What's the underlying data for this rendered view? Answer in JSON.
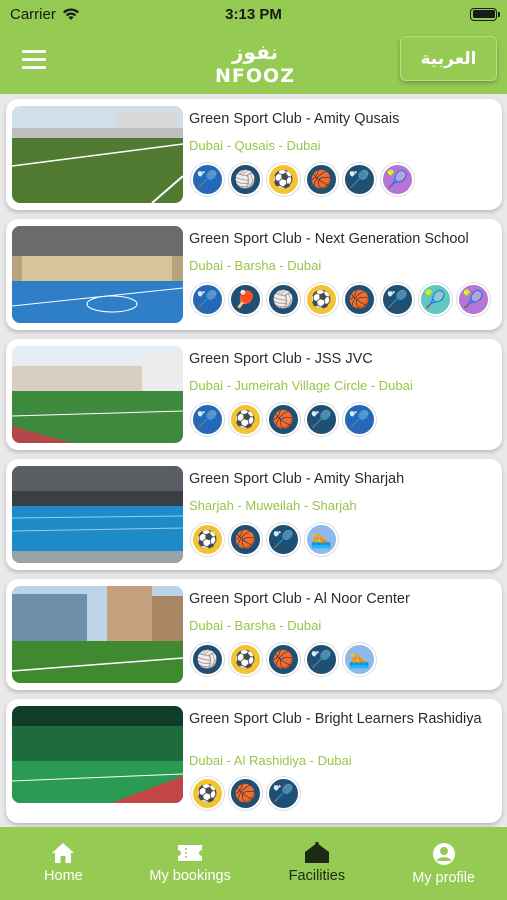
{
  "status": {
    "carrier": "Carrier",
    "time": "3:13 PM"
  },
  "header": {
    "lang_button": "العربية",
    "logo_text": "NFOOZ",
    "logo_arabic": "نفوز"
  },
  "clubs": [
    {
      "title": "Green Sport Club - Amity Qusais",
      "location": "Dubai - Qusais - Dubai",
      "sports": [
        [
          "badminton",
          "s-blue",
          "🏸"
        ],
        [
          "volleyball",
          "s-dark",
          "🏐"
        ],
        [
          "football",
          "s-yellow",
          "⚽"
        ],
        [
          "basketball",
          "s-dark",
          "🏀"
        ],
        [
          "badminton-shuttle",
          "s-dark",
          "🏸"
        ],
        [
          "padel",
          "s-purple",
          "🎾"
        ]
      ]
    },
    {
      "title": "Green Sport Club - Next Generation School",
      "location": "Dubai - Barsha - Dubai",
      "sports": [
        [
          "badminton",
          "s-blue",
          "🏸"
        ],
        [
          "table-tennis",
          "s-dark",
          "🏓"
        ],
        [
          "volleyball",
          "s-dark",
          "🏐"
        ],
        [
          "football",
          "s-yellow",
          "⚽"
        ],
        [
          "basketball",
          "s-dark",
          "🏀"
        ],
        [
          "badminton-shuttle",
          "s-dark",
          "🏸"
        ],
        [
          "tennis",
          "s-green",
          "🎾"
        ],
        [
          "padel",
          "s-purple",
          "🎾"
        ]
      ]
    },
    {
      "title": "Green Sport Club - JSS JVC",
      "location": "Dubai - Jumeirah Village Circle - Dubai",
      "sports": [
        [
          "badminton",
          "s-blue",
          "🏸"
        ],
        [
          "football",
          "s-yellow",
          "⚽"
        ],
        [
          "basketball",
          "s-dark",
          "🏀"
        ],
        [
          "badminton-shuttle",
          "s-dark",
          "🏸"
        ],
        [
          "badminton-alt",
          "s-blue",
          "🏸"
        ]
      ]
    },
    {
      "title": "Green Sport Club - Amity Sharjah",
      "location": "Sharjah - Muweilah - Sharjah",
      "sports": [
        [
          "football",
          "s-yellow",
          "⚽"
        ],
        [
          "basketball",
          "s-dark",
          "🏀"
        ],
        [
          "badminton-shuttle",
          "s-dark",
          "🏸"
        ],
        [
          "swimming",
          "s-light",
          "🏊"
        ]
      ]
    },
    {
      "title": "Green Sport Club - Al Noor Center",
      "location": "Dubai - Barsha - Dubai",
      "sports": [
        [
          "volleyball",
          "s-dark",
          "🏐"
        ],
        [
          "football",
          "s-yellow",
          "⚽"
        ],
        [
          "basketball",
          "s-dark",
          "🏀"
        ],
        [
          "badminton-shuttle",
          "s-dark",
          "🏸"
        ],
        [
          "swimming",
          "s-light",
          "🏊"
        ]
      ]
    },
    {
      "title": "Green Sport Club - Bright Learners Rashidiya",
      "location": "Dubai - Al Rashidiya - Dubai",
      "sports": [
        [
          "football",
          "s-yellow",
          "⚽"
        ],
        [
          "basketball",
          "s-dark",
          "🏀"
        ],
        [
          "badminton-shuttle",
          "s-dark",
          "🏸"
        ]
      ]
    }
  ],
  "tabs": [
    {
      "label": "Home",
      "icon": "home-icon",
      "active": false
    },
    {
      "label": "My bookings",
      "icon": "ticket-icon",
      "active": false
    },
    {
      "label": "Facilities",
      "icon": "facility-icon",
      "active": true
    },
    {
      "label": "My profile",
      "icon": "profile-icon",
      "active": false
    }
  ],
  "colors": {
    "brand": "#95ca53",
    "location": "#9ac34a",
    "active_tab": "#1b2a14"
  }
}
